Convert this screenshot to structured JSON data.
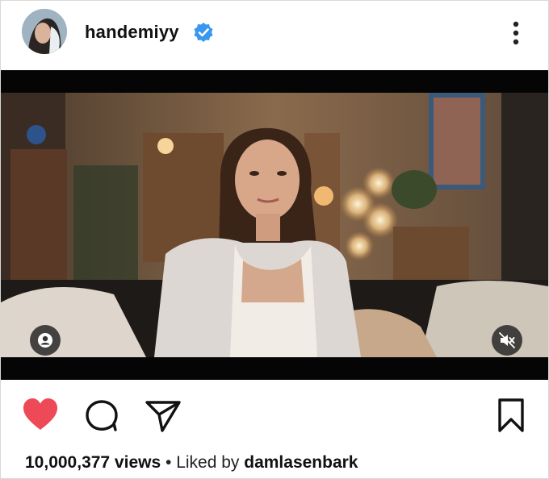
{
  "post": {
    "username": "handemiyy",
    "views": "10,000,377 views",
    "separator": " • ",
    "liked_by_prefix": "Liked by ",
    "liked_by_user": "damlasenbark",
    "liked": true
  },
  "icons": {
    "verified": "verified-badge-icon",
    "more": "more-vertical-icon",
    "like": "heart-icon",
    "comment": "comment-icon",
    "share": "send-icon",
    "save": "bookmark-icon",
    "tags": "person-tag-icon",
    "mute": "muted-speaker-icon"
  },
  "colors": {
    "like": "#ed4956",
    "verified": "#3897f0",
    "text": "#111111"
  }
}
